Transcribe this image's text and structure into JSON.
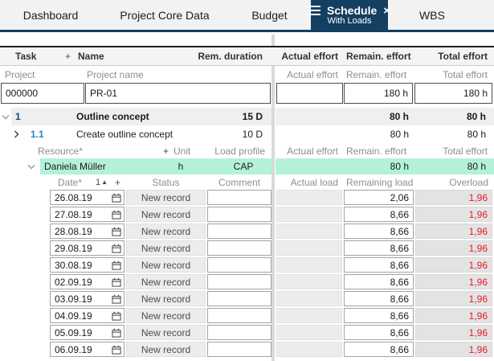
{
  "colors": {
    "accent_navy": "#133f61",
    "highlight_green": "#b3f2d8",
    "overload_red": "#e8192c",
    "wbs_blue": "#1e88c7"
  },
  "icons": {
    "sort_asc": "▲",
    "close": "×",
    "plus": "+"
  },
  "tabs": [
    {
      "label": "Dashboard"
    },
    {
      "label": "Project Core Data"
    },
    {
      "label": "Budget"
    },
    {
      "label": "Schedule",
      "subtitle": "With Loads",
      "active": true
    },
    {
      "label": "WBS"
    }
  ],
  "schedule": {
    "header1": {
      "task": "Task",
      "plus": "+",
      "name": "Name",
      "rem_duration": "Rem. duration",
      "actual_effort": "Actual effort",
      "remain_effort": "Remain. effort",
      "total_effort": "Total effort"
    },
    "header2": {
      "project": "Project",
      "project_name": "Project name",
      "actual_effort": "Actual effort",
      "remain_effort": "Remain. effort",
      "total_effort": "Total effort"
    },
    "project_row": {
      "id": "000000",
      "name": "PR-01",
      "actual_effort": "",
      "remain_effort": "180 h",
      "total_effort": "180 h"
    },
    "tasks": [
      {
        "wbs": "1",
        "name": "Outline concept",
        "rem_duration": "15 D",
        "remain_effort": "80 h",
        "total_effort": "80 h"
      },
      {
        "wbs": "1.1",
        "name": "Create outline concept",
        "rem_duration": "10 D",
        "remain_effort": "80 h",
        "total_effort": "80 h"
      }
    ],
    "resource_header": {
      "resource": "Resource*",
      "plus": "+",
      "unit": "Unit",
      "load_profile": "Load profile",
      "actual_effort": "Actual effort",
      "remain_effort": "Remain. effort",
      "total_effort": "Total effort"
    },
    "resource_row": {
      "name": "Daniela Müller",
      "unit": "h",
      "load_profile": "CAP",
      "actual_effort": "",
      "remain_effort": "80 h",
      "total_effort": "80 h"
    },
    "load_header": {
      "date": "Date*",
      "sort_index": "1",
      "plus": "+",
      "status": "Status",
      "comment": "Comment",
      "actual_load": "Actual load",
      "remaining_load": "Remaining load",
      "overload": "Overload"
    },
    "load_rows": [
      {
        "date": "26.08.19",
        "status": "New record",
        "comment": "",
        "actual_load": "",
        "remaining_load": "2,06",
        "overload": "1,96"
      },
      {
        "date": "27.08.19",
        "status": "New record",
        "comment": "",
        "actual_load": "",
        "remaining_load": "8,66",
        "overload": "1,96"
      },
      {
        "date": "28.08.19",
        "status": "New record",
        "comment": "",
        "actual_load": "",
        "remaining_load": "8,66",
        "overload": "1,96"
      },
      {
        "date": "29.08.19",
        "status": "New record",
        "comment": "",
        "actual_load": "",
        "remaining_load": "8,66",
        "overload": "1,96"
      },
      {
        "date": "30.08.19",
        "status": "New record",
        "comment": "",
        "actual_load": "",
        "remaining_load": "8,66",
        "overload": "1,96"
      },
      {
        "date": "02.09.19",
        "status": "New record",
        "comment": "",
        "actual_load": "",
        "remaining_load": "8,66",
        "overload": "1,96"
      },
      {
        "date": "03.09.19",
        "status": "New record",
        "comment": "",
        "actual_load": "",
        "remaining_load": "8,66",
        "overload": "1,96"
      },
      {
        "date": "04.09.19",
        "status": "New record",
        "comment": "",
        "actual_load": "",
        "remaining_load": "8,66",
        "overload": "1,96"
      },
      {
        "date": "05.09.19",
        "status": "New record",
        "comment": "",
        "actual_load": "",
        "remaining_load": "8,66",
        "overload": "1,96"
      },
      {
        "date": "06.09.19",
        "status": "New record",
        "comment": "",
        "actual_load": "",
        "remaining_load": "8,66",
        "overload": "1,96"
      }
    ]
  }
}
